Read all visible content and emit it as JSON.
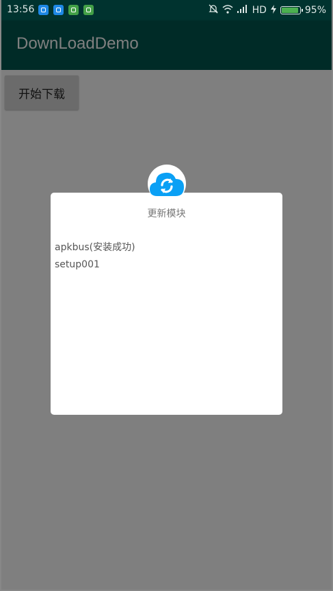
{
  "status_bar": {
    "time": "13:56",
    "network": "HD",
    "battery_percent": "95%",
    "battery_level": 0.95,
    "icons": [
      "usb-icon",
      "app-icon",
      "android-icon",
      "android-icon",
      "mute-icon",
      "wifi-icon",
      "signal-icon",
      "charging-icon",
      "battery-icon"
    ]
  },
  "app_bar": {
    "title": "DownLoadDemo"
  },
  "main": {
    "start_button_label": "开始下载"
  },
  "dialog": {
    "icon": "cloud-sync-icon",
    "title": "更新模块",
    "items": [
      "apkbus(安装成功)",
      "setup001"
    ],
    "accent_color": "#0aa0f5"
  }
}
